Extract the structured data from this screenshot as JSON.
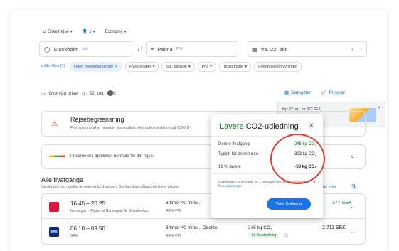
{
  "search": {
    "trip_type": "Enkeltrejse",
    "passengers": "1",
    "cabin": "Economy",
    "from_city": "Stockholm",
    "from_code": "alle",
    "to_city": "Palma",
    "to_code": "PMI",
    "date": "fre. 22. okt."
  },
  "filters": {
    "all": "Alle filtre (1)",
    "active": "Ingen mellemlandinger",
    "items": [
      "Flyselskaber",
      "Stk. bagage",
      "Pris",
      "Tidspunkter",
      "Forbindelsesflyvninger"
    ]
  },
  "tracking": {
    "label": "Overvåg priser",
    "date": "22. okt."
  },
  "date_options": {
    "grid": "Datogitter",
    "graph": "Prisgraf"
  },
  "price_tooltip": {
    "text": "fejs 22. okt. for 372 SEK"
  },
  "restriction": {
    "title": "Rejsebegrænsning",
    "desc": "Fremvisning af et negativt testresultat eller dokumentation på COVID-",
    "more": "ninger"
  },
  "prices_normal": "Priserne er i øjeblikket normale for din rejse.",
  "flights_section": {
    "title": "Alle flyafgange",
    "subtitle": "Samlet pris inkl. afgifter og gebyrer for 1 voksen. Der kan blive pålagt yderligere gebyrer.",
    "sort": "rter efter"
  },
  "flights": [
    {
      "time": "16.45 – 20.25",
      "airline": "Norwegian · Flyves af Norwegian Air Sweden Aoc",
      "duration": "3 timer 40 minu...",
      "route": "ARN–PMI",
      "price": "377 SEK"
    },
    {
      "logo": "SAS",
      "time": "06.10 – 09.50",
      "airline": "SAS",
      "duration": "3 timer 40 minu...  Direkte",
      "route": "ARN–PMI",
      "co2": "245 kg CO₂",
      "badge": "-19 % udledning",
      "price": "2.711 SEK"
    }
  ],
  "co2_popup": {
    "title_green": "Lavere",
    "title_rest": "CO2-udledning",
    "this_flight_label": "Denne flyafgang",
    "this_flight_value": "245 kg CO₂",
    "typical_label": "Typisk for denne rute",
    "typical_value": "303 kg CO₂",
    "diff_label": "19 % lavere",
    "diff_value": "-58 kg CO₂",
    "note": "Udledningen er beregnet for 1 passager i en valgte produkttypen.",
    "note_link": "Få flere oplysninger",
    "button": "Vælg flyafgang"
  },
  "colors": {
    "accent": "#1a73e8",
    "green": "#137333",
    "highlight_circle": "#e03c31"
  }
}
